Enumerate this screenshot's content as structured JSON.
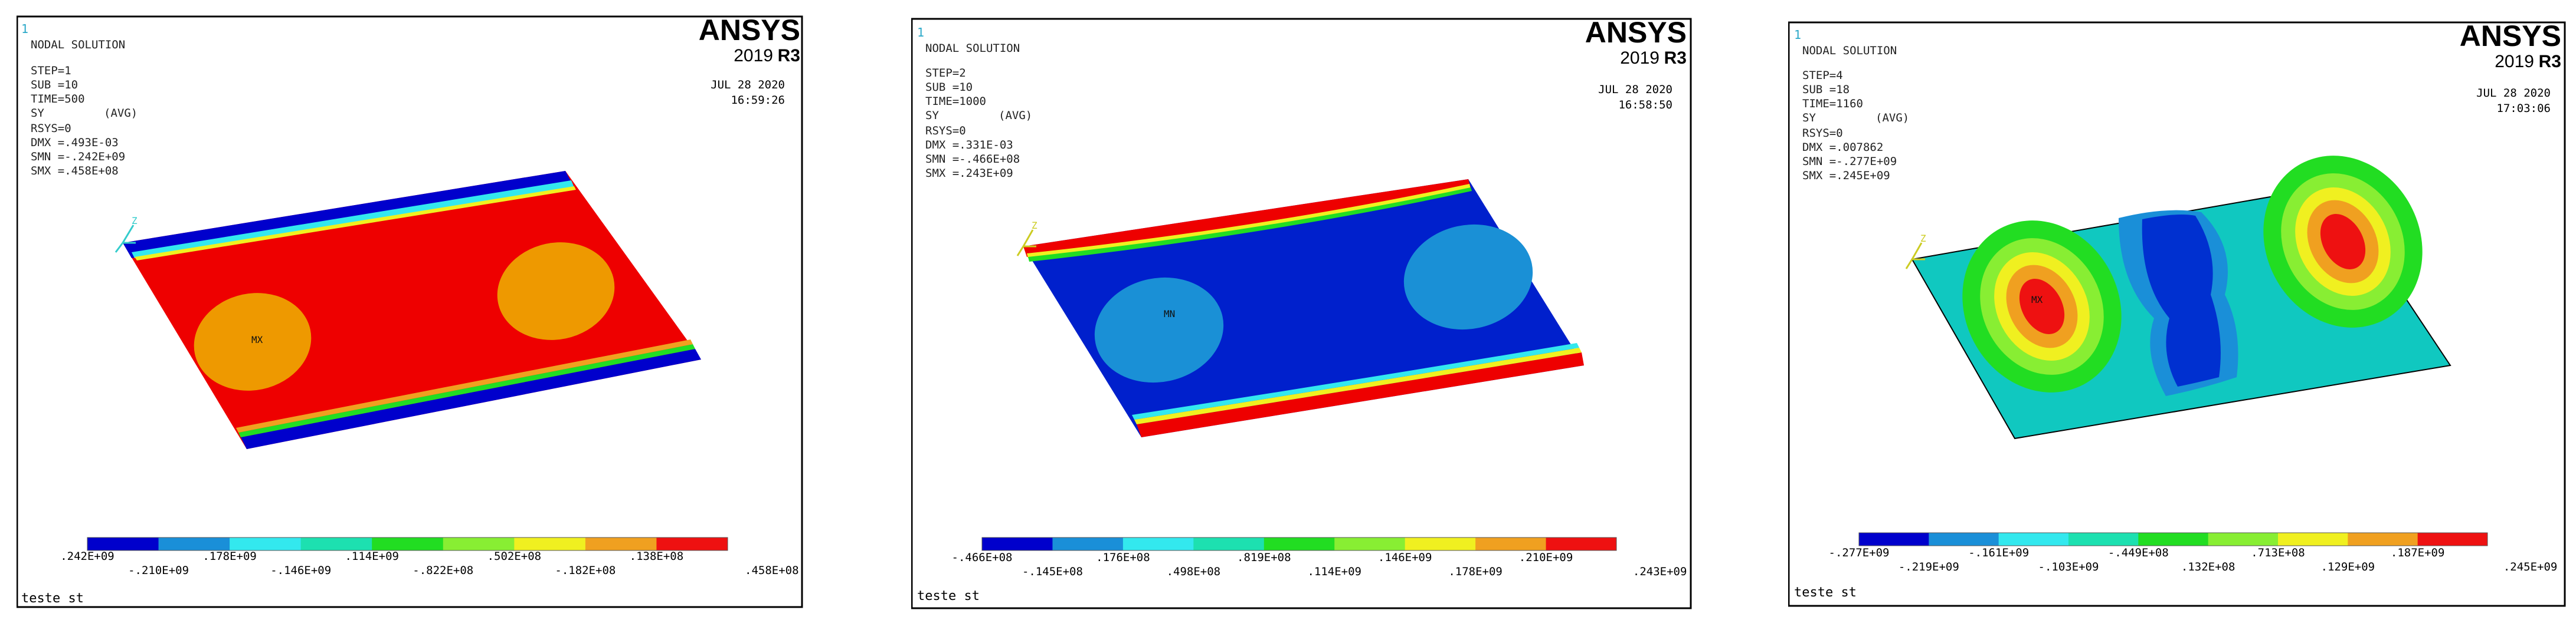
{
  "panels": [
    {
      "title": "NODAL SOLUTION",
      "step": "STEP=1",
      "sub": "SUB =10",
      "time": "TIME=500",
      "result": "SY",
      "avg": "(AVG)",
      "rsys": "RSYS=0",
      "dmx": "DMX =.493E-03",
      "smn": "SMN =-.242E+09",
      "smx": "SMX =.458E+08",
      "brand": "ANSYS",
      "version_year": "2019",
      "version_rel": "R3",
      "date": "JUL 28 2020",
      "clock": "16:59:26",
      "marker": "MX",
      "caption": "teste st",
      "corner": "1",
      "legend_top": [
        ".242E+09",
        ".178E+09",
        ".114E+09",
        ".502E+08",
        ".138E+08"
      ],
      "legend_bottom": [
        "-.210E+09",
        "-.146E+09",
        "-.822E+08",
        "-.182E+08",
        ".458E+08"
      ],
      "colors": {
        "plate": "#ee0000",
        "pad": "#ee9900",
        "edge": "#0000cc"
      }
    },
    {
      "title": "NODAL SOLUTION",
      "step": "STEP=2",
      "sub": "SUB =10",
      "time": "TIME=1000",
      "result": "SY",
      "avg": "(AVG)",
      "rsys": "RSYS=0",
      "dmx": "DMX =.331E-03",
      "smn": "SMN =-.466E+08",
      "smx": "SMX =.243E+09",
      "brand": "ANSYS",
      "version_year": "2019",
      "version_rel": "R3",
      "date": "JUL 28 2020",
      "clock": "16:58:50",
      "marker": "MN",
      "caption": "teste st",
      "corner": "1",
      "legend_top": [
        "-.466E+08",
        ".176E+08",
        ".819E+08",
        ".146E+09",
        ".210E+09"
      ],
      "legend_bottom": [
        "-.145E+08",
        ".498E+08",
        ".114E+09",
        ".178E+09",
        ".243E+09"
      ],
      "colors": {
        "plate": "#0020cc",
        "pad": "#1a90d6",
        "edge": "#ee0000"
      }
    },
    {
      "title": "NODAL SOLUTION",
      "step": "STEP=4",
      "sub": "SUB =18",
      "time": "TIME=1160",
      "result": "SY",
      "avg": "(AVG)",
      "rsys": "RSYS=0",
      "dmx": "DMX =.007862",
      "smn": "SMN =-.277E+09",
      "smx": "SMX =.245E+09",
      "brand": "ANSYS",
      "version_year": "2019",
      "version_rel": "R3",
      "date": "JUL 28 2020",
      "clock": "17:03:06",
      "marker": "MX",
      "caption": "teste st",
      "corner": "1",
      "legend_top": [
        "-.277E+09",
        "-.161E+09",
        "-.449E+08",
        ".713E+08",
        ".187E+09"
      ],
      "legend_bottom": [
        "-.219E+09",
        "-.103E+09",
        ".132E+08",
        ".129E+09",
        ".245E+09"
      ],
      "colors": {
        "plate": "#10c8c0",
        "pad": "#e80000",
        "edge": "#0030d0"
      }
    }
  ],
  "contour_colors": [
    "#0000cc",
    "#1a8fd8",
    "#33e8ee",
    "#1de0b0",
    "#22dd22",
    "#88ee33",
    "#f0f020",
    "#f0a020",
    "#ee1111"
  ]
}
